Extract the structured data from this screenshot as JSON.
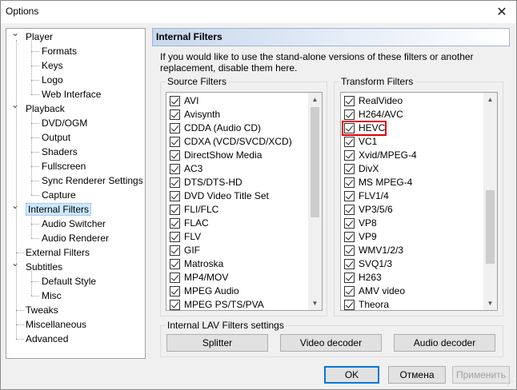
{
  "window": {
    "title": "Options",
    "close_glyph": "✕"
  },
  "tree": {
    "items": [
      {
        "label": "Player",
        "level": 0,
        "expander": "collapse"
      },
      {
        "label": "Formats",
        "level": 1
      },
      {
        "label": "Keys",
        "level": 1
      },
      {
        "label": "Logo",
        "level": 1
      },
      {
        "label": "Web Interface",
        "level": 1
      },
      {
        "label": "Playback",
        "level": 0,
        "expander": "collapse"
      },
      {
        "label": "DVD/OGM",
        "level": 1
      },
      {
        "label": "Output",
        "level": 1
      },
      {
        "label": "Shaders",
        "level": 1
      },
      {
        "label": "Fullscreen",
        "level": 1
      },
      {
        "label": "Sync Renderer Settings",
        "level": 1
      },
      {
        "label": "Capture",
        "level": 1
      },
      {
        "label": "Internal Filters",
        "level": 0,
        "expander": "collapse",
        "selected": true
      },
      {
        "label": "Audio Switcher",
        "level": 1
      },
      {
        "label": "Audio Renderer",
        "level": 1
      },
      {
        "label": "External Filters",
        "level": 0
      },
      {
        "label": "Subtitles",
        "level": 0,
        "expander": "collapse"
      },
      {
        "label": "Default Style",
        "level": 1
      },
      {
        "label": "Misc",
        "level": 1
      },
      {
        "label": "Tweaks",
        "level": 0
      },
      {
        "label": "Miscellaneous",
        "level": 0
      },
      {
        "label": "Advanced",
        "level": 0
      }
    ]
  },
  "page": {
    "header": "Internal Filters",
    "description": "If you would like to use the stand-alone versions of these filters or another replacement, disable them here."
  },
  "source_filters": {
    "title": "Source Filters",
    "items": [
      "AVI",
      "Avisynth",
      "CDDA (Audio CD)",
      "CDXA (VCD/SVCD/XCD)",
      "DirectShow Media",
      "AC3",
      "DTS/DTS-HD",
      "DVD Video Title Set",
      "FLI/FLC",
      "FLAC",
      "FLV",
      "GIF",
      "Matroska",
      "MP4/MOV",
      "MPEG Audio",
      "MPEG PS/TS/PVA"
    ]
  },
  "transform_filters": {
    "title": "Transform Filters",
    "items": [
      "RealVideo",
      "H264/AVC",
      "HEVC",
      "VC1",
      "Xvid/MPEG-4",
      "DivX",
      "MS MPEG-4",
      "FLV1/4",
      "VP3/5/6",
      "VP8",
      "VP9",
      "WMV1/2/3",
      "SVQ1/3",
      "H263",
      "AMV video",
      "Theora"
    ],
    "highlighted": "HEVC"
  },
  "lav": {
    "title": "Internal LAV Filters settings",
    "buttons": [
      "Splitter",
      "Video decoder",
      "Audio decoder"
    ]
  },
  "footer": {
    "ok": "OK",
    "cancel": "Отмена",
    "apply": "Применить"
  },
  "icons": {
    "collapse": "chevron-down-icon",
    "scroll_up": "arrow-up-icon",
    "scroll_down": "arrow-down-icon"
  },
  "colors": {
    "highlight_box": "#e00000",
    "selection": "#cce8ff",
    "header_gradient_start": "#c7d8ee"
  }
}
